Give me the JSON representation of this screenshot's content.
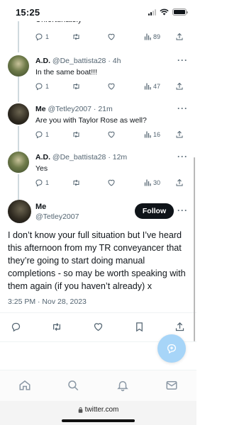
{
  "status_bar": {
    "time": "15:25"
  },
  "top_cut": {
    "text": "Unfortunately",
    "actions": {
      "replies": "1",
      "views": "89"
    }
  },
  "replies": [
    {
      "name": "A.D.",
      "handle": "@De_battista28",
      "time": "4h",
      "text": "In the same boat!!!",
      "replies": "1",
      "views": "47",
      "avatar": "plant"
    },
    {
      "name": "Me",
      "handle": "@Tetley2007",
      "time": "21m",
      "text": "Are you with Taylor Rose as well?",
      "replies": "1",
      "views": "16",
      "avatar": "dark"
    },
    {
      "name": "A.D.",
      "handle": "@De_battista28",
      "time": "12m",
      "text": "Yes",
      "replies": "1",
      "views": "30",
      "avatar": "plant"
    }
  ],
  "main_tweet": {
    "name": "Me",
    "handle": "@Tetley2007",
    "follow_label": "Follow",
    "text": "I don’t know your full situation but I’ve heard this afternoon from my TR conveyancer that they’re going to start doing manual completions - so may be worth speaking with them again (if you haven’t already) x",
    "timestamp": "3:25 PM · Nov 28, 2023"
  },
  "browser": {
    "url": "twitter.com"
  },
  "colors": {
    "text": "#0f1419",
    "muted": "#536471",
    "accent": "#1d9bf0",
    "fab": "#a7d5f8"
  },
  "icons": [
    "reply-icon",
    "retweet-icon",
    "like-icon",
    "views-icon",
    "more-icon",
    "bookmark-icon",
    "share-icon",
    "home-icon",
    "search-icon",
    "notifications-icon",
    "messages-icon",
    "compose-icon",
    "lock-icon"
  ]
}
